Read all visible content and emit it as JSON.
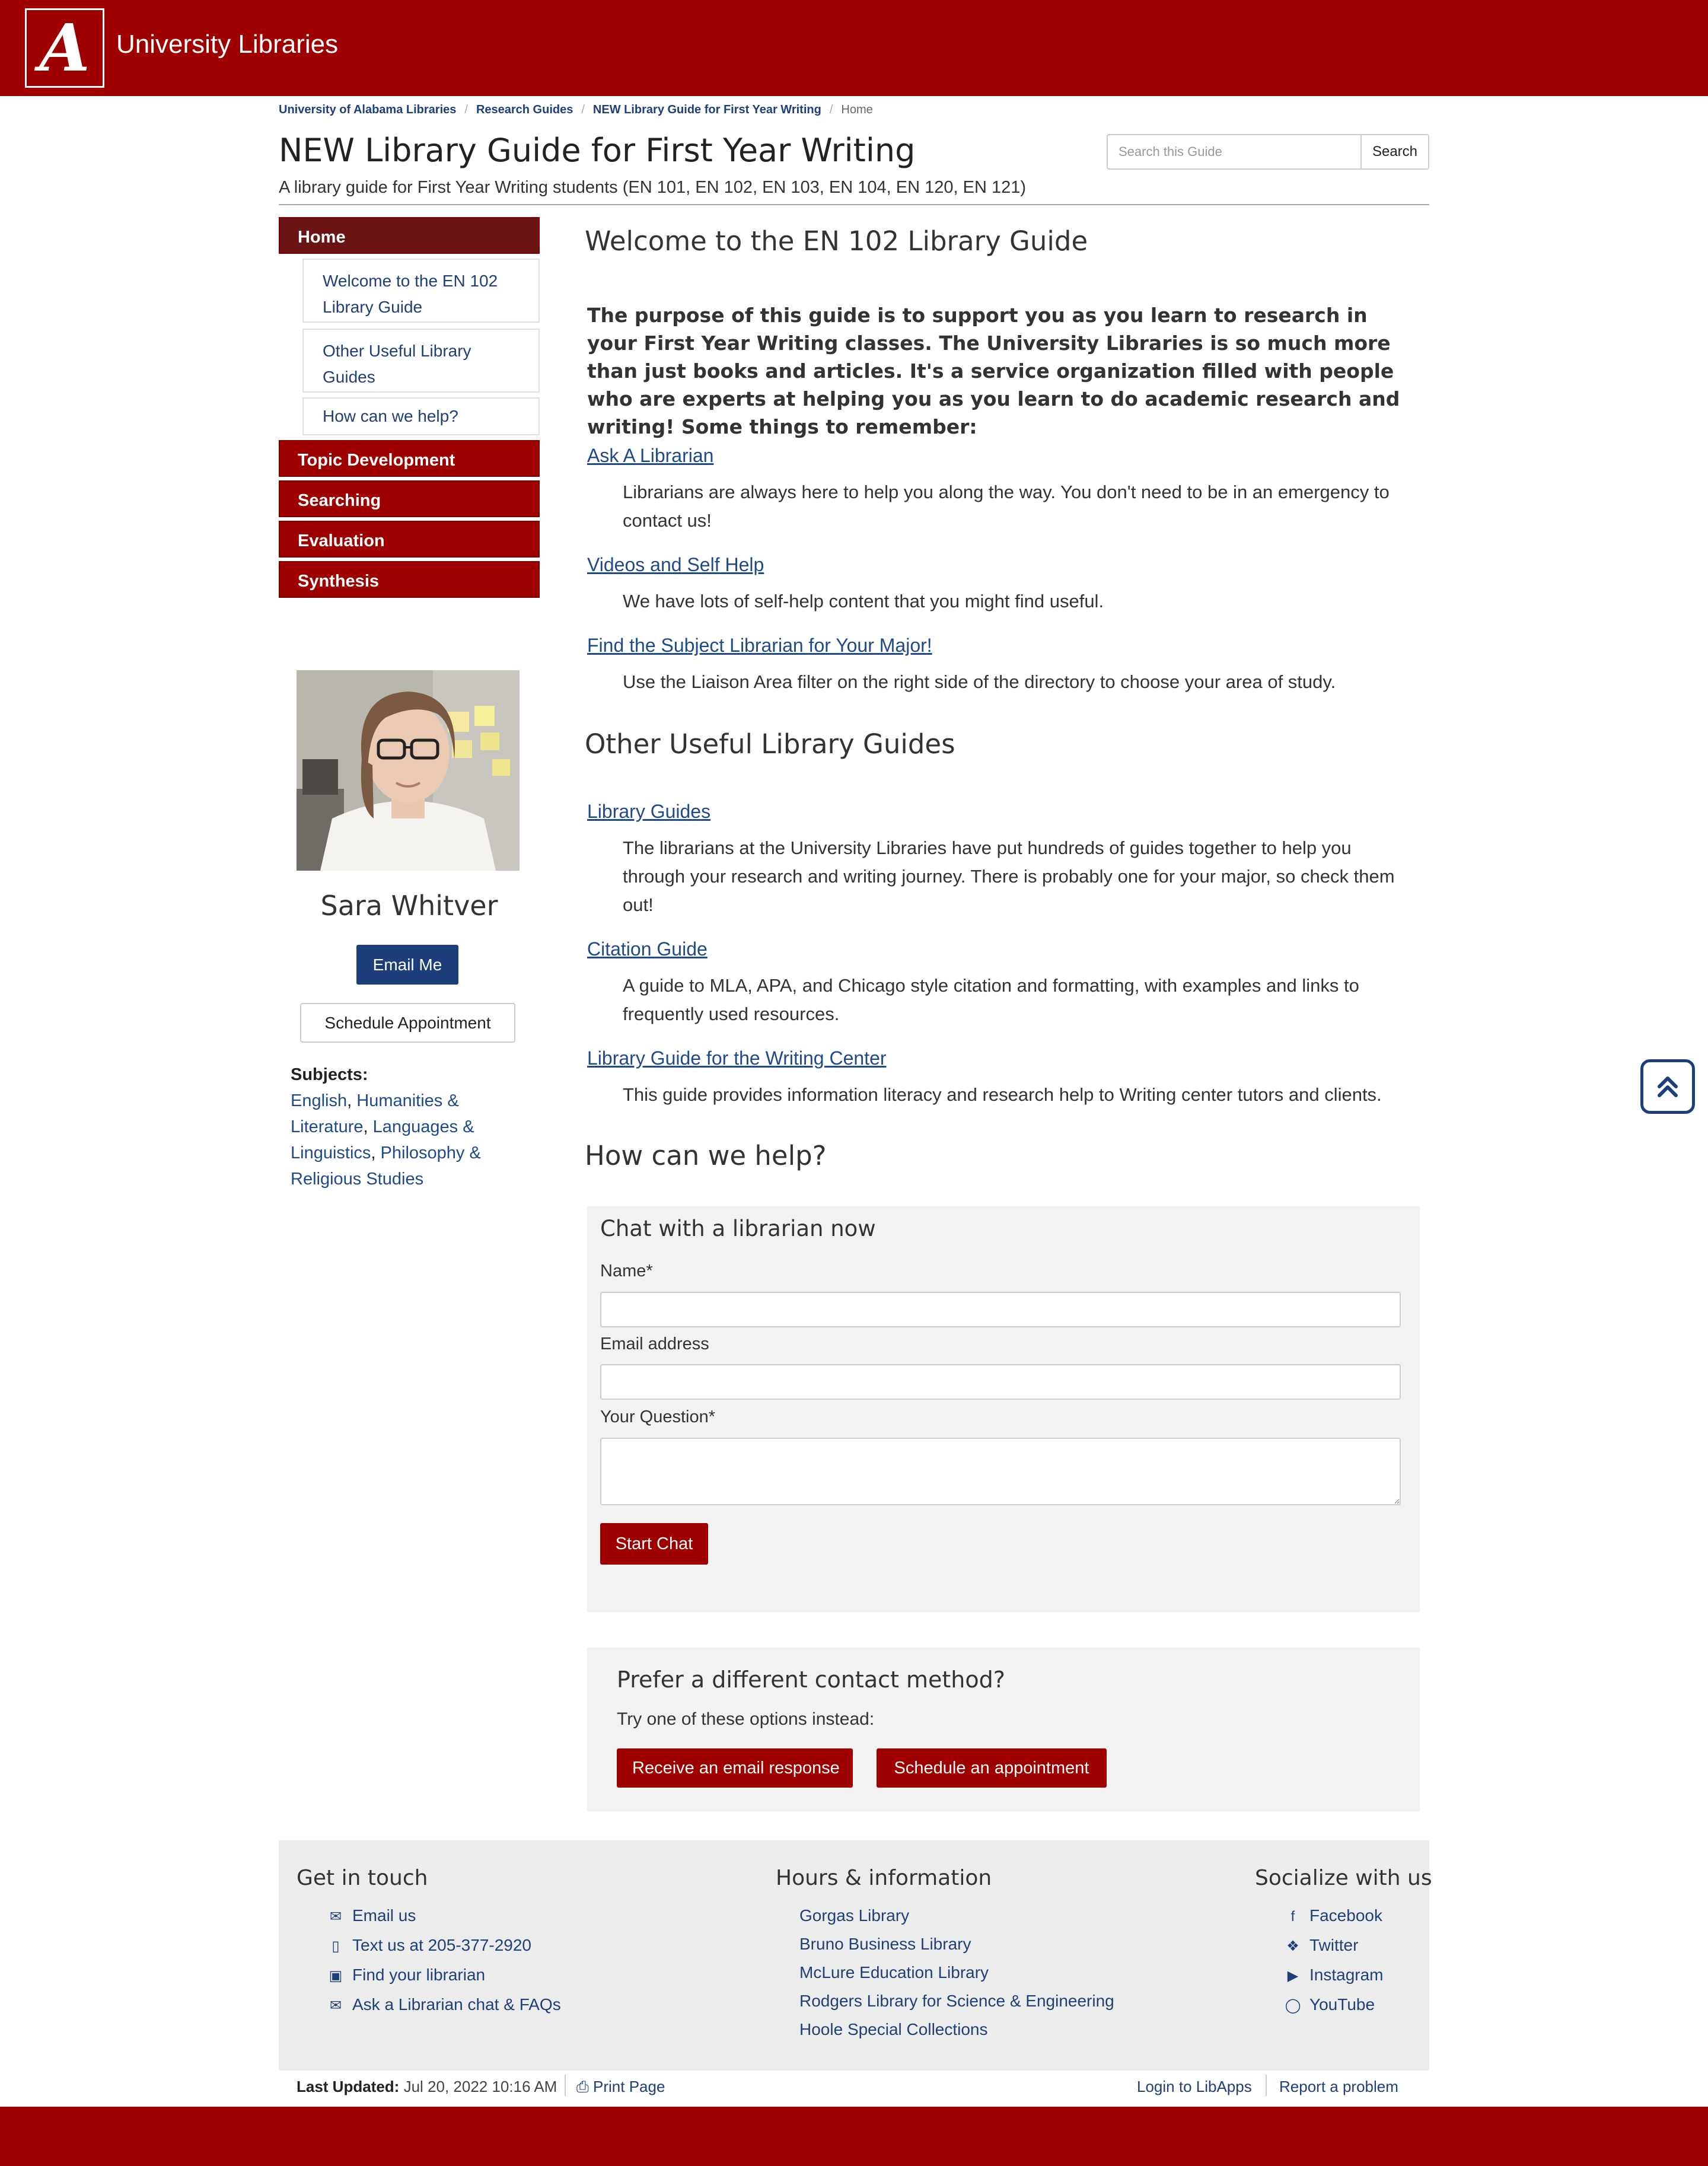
{
  "header": {
    "logo_letter": "A",
    "site_name": "University Libraries"
  },
  "breadcrumb": [
    "University of Alabama Libraries",
    "Research Guides",
    "NEW Library Guide for First Year Writing",
    "Home"
  ],
  "guide": {
    "title": "NEW Library Guide for First Year Writing",
    "subtitle": "A library guide for First Year Writing students (EN 101, EN 102, EN 103, EN 104, EN 120, EN 121)"
  },
  "search": {
    "placeholder": "Search this Guide",
    "button": "Search"
  },
  "nav": {
    "home": "Home",
    "subitems": [
      "Welcome to the EN 102 Library Guide",
      "Other Useful Library Guides",
      "How can we help?"
    ],
    "sections": [
      "Topic Development",
      "Searching",
      "Evaluation",
      "Synthesis"
    ]
  },
  "profile": {
    "name": "Sara Whitver",
    "email_button": "Email Me",
    "schedule_button": "Schedule Appointment",
    "subjects_label": "Subjects:",
    "subjects": [
      "English",
      "Humanities & Literature",
      "Languages & Linguistics",
      "Philosophy & Religious Studies"
    ]
  },
  "main": {
    "welcome_heading": "Welcome to the EN 102 Library Guide",
    "intro": "The purpose of this guide is to support you as you learn to research in your First Year Writing classes. The University Libraries is so much more than just books and articles. It's a service organization filled with people who are experts at helping you as you learn to do academic research and writing! Some things to remember:",
    "resources": [
      {
        "link": "Ask A Librarian",
        "desc": "Librarians are always here to help you along the way. You don't need to be in an emergency to contact us!"
      },
      {
        "link": "Videos and Self Help",
        "desc": "We have lots of self-help content that you might find useful."
      },
      {
        "link": "Find the Subject Librarian for Your Major!",
        "desc": "Use the Liaison Area filter on the right side of the directory to choose your area of study."
      }
    ],
    "other_heading": "Other Useful Library Guides",
    "other_guides": [
      {
        "link": "Library Guides",
        "desc": "The librarians at the University Libraries have put hundreds of guides together to help you through your research and writing journey. There is probably one for your major, so check them out!"
      },
      {
        "link": "Citation Guide",
        "desc": "A guide to MLA, APA, and Chicago style citation and formatting, with examples and links to frequently used resources."
      },
      {
        "link": "Library Guide for the Writing Center",
        "desc": "This guide provides information literacy and research help to Writing center tutors and clients."
      }
    ],
    "help_heading": "How can we help?"
  },
  "chat": {
    "title": "Chat with a librarian now",
    "name_label": "Name*",
    "name_value": "",
    "email_label": "Email address",
    "email_value": "",
    "question_label": "Your Question*",
    "question_value": "",
    "start_button": "Start Chat"
  },
  "alt_contact": {
    "title": "Prefer a different contact method?",
    "text": "Try one of these options instead:",
    "email_button": "Receive an email response",
    "appointment_button": "Schedule an appointment"
  },
  "footer": {
    "contact_heading": "Get in touch",
    "contact_links": [
      {
        "icon": "envelope-icon",
        "label": "Email us"
      },
      {
        "icon": "mobile-icon",
        "label": "Text us at 205-377-2920"
      },
      {
        "icon": "contact-card-icon",
        "label": "Find your librarian"
      },
      {
        "icon": "chat-bubbles-icon",
        "label": "Ask a Librarian chat & FAQs"
      }
    ],
    "hours_heading": "Hours & information",
    "hours_links": [
      "Gorgas Library",
      "Bruno Business Library",
      "McLure Education Library",
      "Rodgers Library for Science & Engineering",
      "Hoole Special Collections"
    ],
    "social_heading": "Socialize with us",
    "social_links": [
      {
        "icon": "facebook-icon",
        "label": "Facebook"
      },
      {
        "icon": "twitter-icon",
        "label": "Twitter"
      },
      {
        "icon": "youtube-icon",
        "label": "Instagram"
      },
      {
        "icon": "instagram-icon",
        "label": "YouTube"
      }
    ],
    "last_updated_label": "Last Updated:",
    "last_updated_value": "Jul 20, 2022 10:16 AM",
    "print": "Print Page",
    "login": "Login to LibApps",
    "report": "Report a problem"
  },
  "colors": {
    "brand_red": "#9e0000",
    "nav_active": "#6b1414",
    "link_blue": "#1f4a8a",
    "button_blue": "#1c3f7c"
  }
}
